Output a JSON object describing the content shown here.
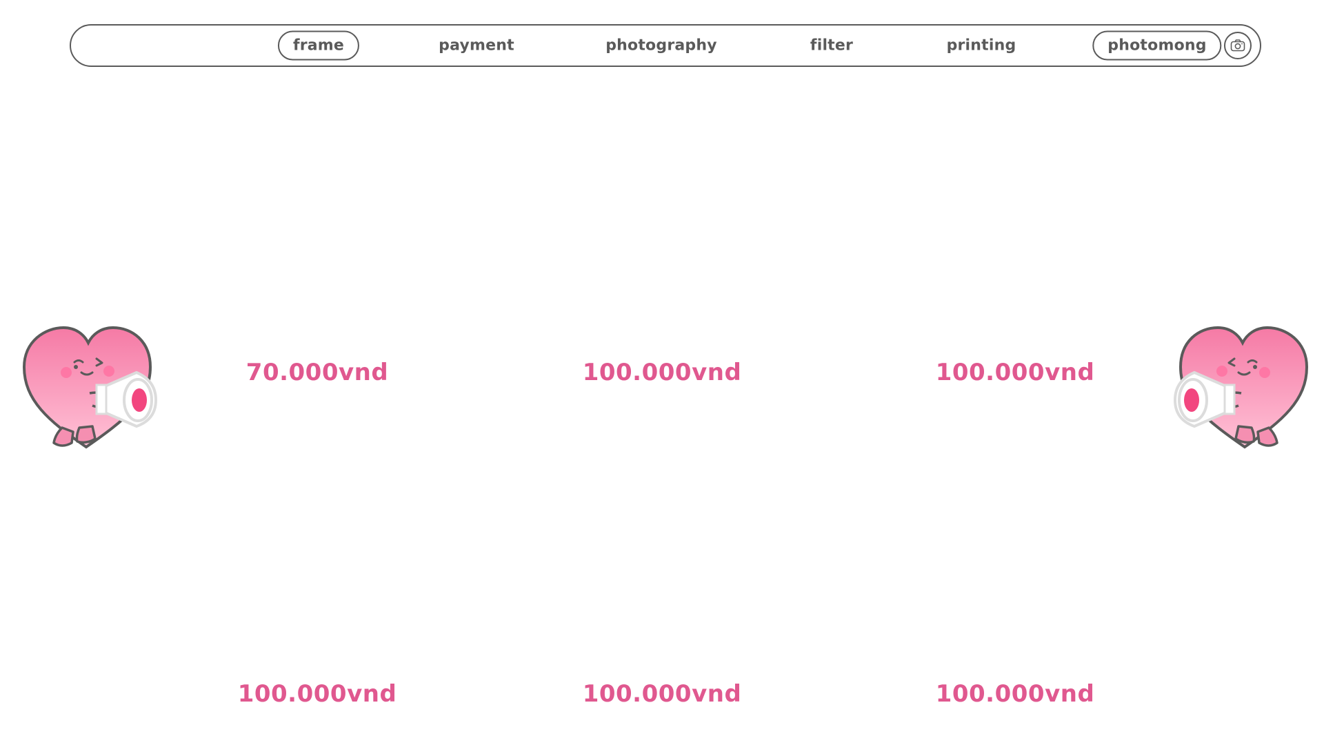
{
  "nav": {
    "items": [
      {
        "label": "frame",
        "active": true
      },
      {
        "label": "payment",
        "active": false
      },
      {
        "label": "photography",
        "active": false
      },
      {
        "label": "filter",
        "active": false
      },
      {
        "label": "printing",
        "active": false
      }
    ],
    "brand": "photomong",
    "camera_icon": "camera-icon"
  },
  "frames": [
    {
      "price": "70.000vnd"
    },
    {
      "price": "100.000vnd"
    },
    {
      "price": "100.000vnd"
    },
    {
      "price": "100.000vnd"
    },
    {
      "price": "100.000vnd"
    },
    {
      "price": "100.000vnd"
    }
  ],
  "mascot_icon": "heart-megaphone-mascot",
  "colors": {
    "accent": "#e0588f",
    "text": "#5a5a5a",
    "heart_pink": "#f58fb1"
  }
}
